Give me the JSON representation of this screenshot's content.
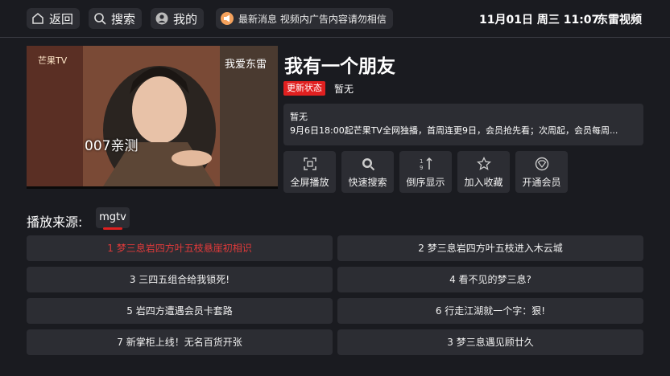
{
  "topbar": {
    "back_label": "返回",
    "search_label": "搜索",
    "mine_label": "我的",
    "news_text": "最新消息  视频内广告内容请勿相信",
    "clock": "11月01日 周三 11:07",
    "brand": "东雷视频"
  },
  "video": {
    "watermark_left": "芒果TV",
    "watermark_right": "我爱东雷",
    "overlay_text": "007亲测"
  },
  "detail": {
    "title": "我有一个朋友",
    "status_badge": "更新状态",
    "status_value": "暂无",
    "desc_line1": "暂无",
    "desc_line2": "9月6日18:00起芒果TV全网独播，首周连更9日，会员抢先看；次周起，会员每周..."
  },
  "actions": [
    {
      "label": "全屏播放",
      "icon": "fullscreen-icon"
    },
    {
      "label": "快速搜索",
      "icon": "search-icon"
    },
    {
      "label": "倒序显示",
      "icon": "sort-icon"
    },
    {
      "label": "加入收藏",
      "icon": "star-icon"
    },
    {
      "label": "开通会员",
      "icon": "vip-icon"
    }
  ],
  "source": {
    "label": "播放来源:",
    "tab": "mgtv"
  },
  "episodes": [
    "1 梦三息岩四方叶五枝悬崖初相识",
    "2 梦三息岩四方叶五枝进入木云城",
    "3 三四五组合给我锁死!",
    "4 看不见的梦三息?",
    "5 岩四方遭遇会员卡套路",
    "6 行走江湖就一个字：狠!",
    "7 新掌柜上线！无名百货开张",
    "3 梦三息遇见顾廿久"
  ],
  "colors": {
    "background": "#1a1b20",
    "panel": "#2c2d33",
    "accent_red": "#e02020",
    "active_episode": "#e03a3a"
  }
}
